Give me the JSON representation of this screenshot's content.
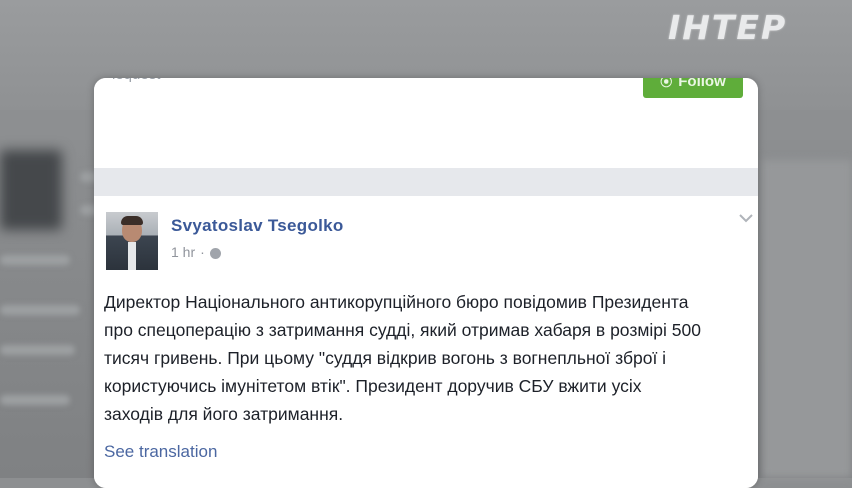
{
  "channel": {
    "logo_text": "ІНТЕР"
  },
  "header": {
    "request_label": "lequest",
    "follow_label": "Follow",
    "follow_color": "#5fad3a"
  },
  "post": {
    "author": "Svyatoslav Tsegolko",
    "time": "1 hr",
    "separator": "·",
    "privacy_icon": "globe-icon",
    "menu_icon": "chevron-down-icon",
    "text_lines": [
      "Директор Національного антикорупційного бюро повідомив Президента",
      "про спецоперацію з затримання судді, який отримав хабаря в розмірі 500",
      "тисяч гривень. При цьому \"суддя відкрив вогонь з вогнепльної зброї і",
      "користуючись імунітетом втік\". Президент доручив СБУ вжити усіх",
      "заходів для його затримання."
    ],
    "see_translation": "See translation",
    "author_color": "#3b5998"
  }
}
